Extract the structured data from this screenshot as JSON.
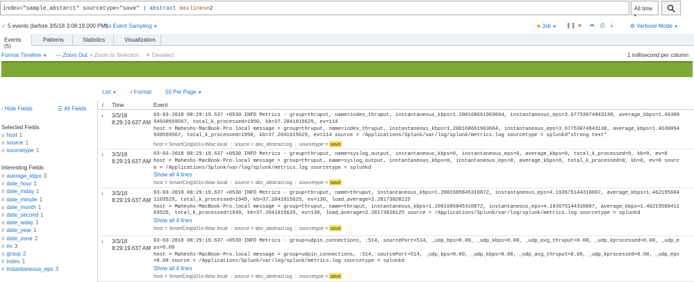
{
  "search": {
    "query_index_part": "index=\"sample_abstarct\" sourcetype=\"save\"",
    "query_pipe": " | ",
    "query_cmd": "abstract",
    "query_arg_key": " maxlines",
    "query_arg_val": "=2",
    "time_range": "All time",
    "time_caret": "▾"
  },
  "status": {
    "events_text": "5 events (before 3/5/18 3:08:19.000 PM)",
    "sampling": "No Event Sampling",
    "job": "Job",
    "mode": "Verbose Mode"
  },
  "tabs": [
    {
      "label": "Events (5)"
    },
    {
      "label": "Patterns"
    },
    {
      "label": "Statistics"
    },
    {
      "label": "Visualization"
    }
  ],
  "timeline": {
    "format": "Format Timeline",
    "zoom_out": "— Zoom Out",
    "zoom_sel": "+ Zoom to Selection",
    "deselect": "✕ Deselect",
    "scale": "1 millisecond per column"
  },
  "list_controls": {
    "list": "List",
    "format": "Format",
    "per_page": "50 Per Page"
  },
  "sidebar": {
    "hide_fields": "Hide Fields",
    "all_fields": "All Fields",
    "selected_heading": "Selected Fields",
    "selected": [
      {
        "type": "a",
        "name": "host",
        "count": "1"
      },
      {
        "type": "a",
        "name": "source",
        "count": "1"
      },
      {
        "type": "a",
        "name": "sourcetype",
        "count": "1"
      }
    ],
    "interesting_heading": "Interesting Fields",
    "interesting": [
      {
        "type": "#",
        "name": "average_kbps",
        "count": "3"
      },
      {
        "type": "#",
        "name": "date_hour",
        "count": "1"
      },
      {
        "type": "#",
        "name": "date_mday",
        "count": "1"
      },
      {
        "type": "#",
        "name": "date_minute",
        "count": "1"
      },
      {
        "type": "a",
        "name": "date_month",
        "count": "1"
      },
      {
        "type": "#",
        "name": "date_second",
        "count": "1"
      },
      {
        "type": "a",
        "name": "date_wday",
        "count": "1"
      },
      {
        "type": "#",
        "name": "date_year",
        "count": "1"
      },
      {
        "type": "#",
        "name": "date_zone",
        "count": "2"
      },
      {
        "type": "#",
        "name": "ev",
        "count": "3"
      },
      {
        "type": "a",
        "name": "group",
        "count": "2"
      },
      {
        "type": "#",
        "name": "index",
        "count": "1"
      },
      {
        "type": "#",
        "name": "instantaneous_eps",
        "count": "3"
      }
    ]
  },
  "table": {
    "col_i": "i",
    "col_time": "Time",
    "col_event": "Event"
  },
  "events": [
    {
      "date": "3/3/18",
      "time": "8:29:19.637 AM",
      "raw": "03-03-2018 08:29:19.637 +0530 INFO Metrics - group=thruput, name=index_thruput, instantaneous_kbps=1.200168661963664, instantaneous_eps=3.67753074843138, average_kbps=1.46300\n94930559567, total_k_processed=1950, kb=37.2041015625, ev=114\nhost = Maheshs-MacBook-Pro.local message = group=thruput, name=index_thruput, instantaneous_kbps=1.200168661963664, instantaneous_eps=3.67753074843138, average_kbps=1.4630094\n930559567, total_k_processed=1950, kb=37.2041015625, ev=114 source = /Applications/Splunk/var/log/splunk/metrics.log sourcetype = splunkd*strong text*",
      "show_more": "",
      "host": "SmartCirq|s01s-iMac.local",
      "source": "abc_abstract.log",
      "sourcetype": "save"
    },
    {
      "date": "3/3/18",
      "time": "8:29:19.637 AM",
      "raw": "03-03-2018 08:29:19.637 +0530 INFO Metrics - group=thruput, name=syslog_output, instantaneous_kbps=0, instantaneous_eps=0, average_kbps=0, total_k_processed=0, kb=0, ev=0\nhost = Maheshs-MacBook-Pro.local message = group=thruput, name=syslog_output, instantaneous_kbps=0, instantaneous_eps=0, average_kbps=0, total_k_processed=0, kb=0, ev=0 sourc\ne = /Applications/Splunk/var/log/splunk/metrics.log sourcetype = splunkd",
      "show_more": "Show all 4 lines",
      "host": "SmartCirq|s01s-iMac.local",
      "source": "abc_abstract.log",
      "sourcetype": "save"
    },
    {
      "date": "3/3/18",
      "time": "8:29:19.637 AM",
      "raw": "03-03-2018 08:29:19.637 +0530 INFO Metrics - group=thruput, name=thruput, instantaneous_kbps=1.2001685845310872, instantaneous_eps=4.193675144310007, average_kbps=1.462195604\n1103525, total_k_processed=1949, kb=37.2041015625, ev=130, load_average=2.28173828125\nhost = Maheshs-MacBook-Pro.local message = group=thruput, name=thruput, instantaneous_kbps=1.2001685845310872, instantaneous_eps=4.193675144310007, average_kbps=1.46219560411\n03525, total_k_processed=1949, kb=37.2041015625, ev=130, load_average=2.28173828125 source = /Applications/Splunk/var/log/splunk/metrics.log sourcetype = splunkd",
      "show_more": "Show all 4 lines",
      "host": "SmartCirq|s01s-iMac.local",
      "source": "abc_abstract.log",
      "sourcetype": "save"
    },
    {
      "date": "3/3/18",
      "time": "8:29:19.637 AM",
      "raw": "03-03-2018 08:29:19.637 +0530 INFO Metrics - group=udpin_connections, :514, sourcePort=514, _udp_bps=0.00, _udp_kbps=0.00, _udp_avg_thruput=0.00, _udp_kprocessed=0.00, _udp_e\nps=0.00\nhost = Maheshs-MacBook-Pro.local message = group=udpin_connections, :514, sourcePort=514, _udp_bps=0.00, _udp_kbps=0.00, _udp_avg_thruput=0.00, _udp_kprocessed=0.00, _udp_eps\n=0.00 source = /Applications/Splunk/var/log/splunk/metrics.log sourcetype = splunkd",
      "show_more": "Show all 4 lines",
      "host": "SmartCirq|s01s-iMac.local",
      "source": "abc_abstract.log",
      "sourcetype": "save"
    }
  ],
  "meta_labels": {
    "host": "host =",
    "source": "source =",
    "sourcetype": "sourcetype ="
  },
  "colors": {
    "link": "#1e73be",
    "timeline": "#7ea838",
    "highlight": "#f2e15d"
  }
}
